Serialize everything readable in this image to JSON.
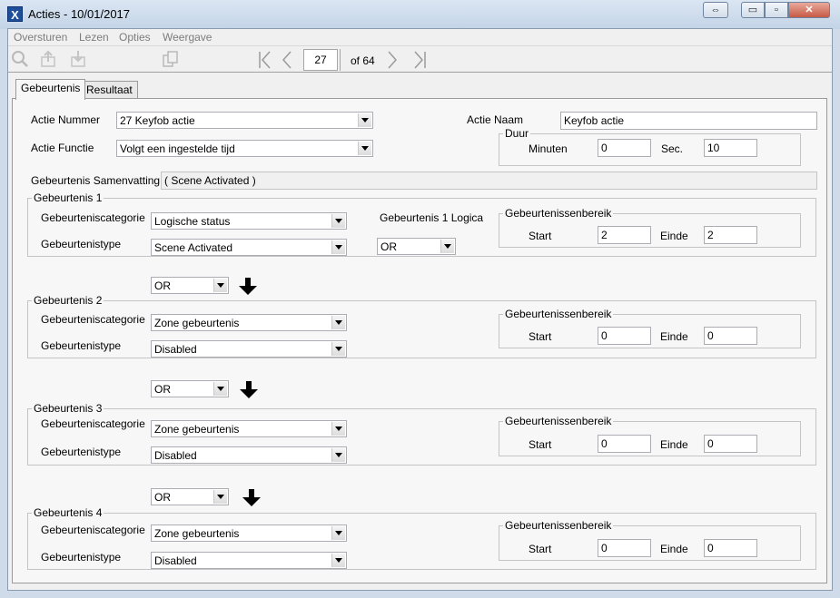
{
  "window": {
    "title": "Acties - 10/01/2017",
    "app_icon_letter": "X",
    "buttons": {
      "restore_symbol": "⇔",
      "minimize_symbol": "▭",
      "maximize_symbol": "▫",
      "close_symbol": "✕"
    }
  },
  "menu": [
    "Oversturen",
    "Lezen",
    "Opties",
    "Weergave"
  ],
  "toolbar": {
    "page": "27",
    "of_label": "of 64"
  },
  "tabs": [
    "Gebeurtenis",
    "Resultaat"
  ],
  "form": {
    "actie_nummer_label": "Actie Nummer",
    "actie_nummer_value": "27 Keyfob actie",
    "actie_functie_label": "Actie Functie",
    "actie_functie_value": "Volgt een ingestelde tijd",
    "actie_naam_label": "Actie Naam",
    "actie_naam_value": "Keyfob actie",
    "duur": {
      "legend": "Duur",
      "minuten_label": "Minuten",
      "minuten_value": "0",
      "sec_label": "Sec.",
      "sec_value": "10"
    },
    "samenvatting_label": "Gebeurtenis Samenvatting",
    "samenvatting_value": "( Scene Activated )"
  },
  "events": [
    {
      "legend": "Gebeurtenis 1",
      "cat_label": "Gebeurteniscategorie",
      "cat_value": "Logische status",
      "type_label": "Gebeurtenistype",
      "type_value": "Scene Activated",
      "logic_label": "Gebeurtenis 1 Logica",
      "logic_value": "OR",
      "range_legend": "Gebeurtenissenbereik",
      "start_label": "Start",
      "start_value": "2",
      "einde_label": "Einde",
      "einde_value": "2"
    },
    {
      "legend": "Gebeurtenis 2",
      "cat_label": "Gebeurteniscategorie",
      "cat_value": "Zone gebeurtenis",
      "type_label": "Gebeurtenistype",
      "type_value": "Disabled",
      "range_legend": "Gebeurtenissenbereik",
      "start_label": "Start",
      "start_value": "0",
      "einde_label": "Einde",
      "einde_value": "0"
    },
    {
      "legend": "Gebeurtenis 3",
      "cat_label": "Gebeurteniscategorie",
      "cat_value": "Zone gebeurtenis",
      "type_label": "Gebeurtenistype",
      "type_value": "Disabled",
      "range_legend": "Gebeurtenissenbereik",
      "start_label": "Start",
      "start_value": "0",
      "einde_label": "Einde",
      "einde_value": "0"
    },
    {
      "legend": "Gebeurtenis 4",
      "cat_label": "Gebeurteniscategorie",
      "cat_value": "Zone gebeurtenis",
      "type_label": "Gebeurtenistype",
      "type_value": "Disabled",
      "range_legend": "Gebeurtenissenbereik",
      "start_label": "Start",
      "start_value": "0",
      "einde_label": "Einde",
      "einde_value": "0"
    }
  ],
  "connectors": [
    {
      "value": "OR"
    },
    {
      "value": "OR"
    },
    {
      "value": "OR"
    }
  ]
}
